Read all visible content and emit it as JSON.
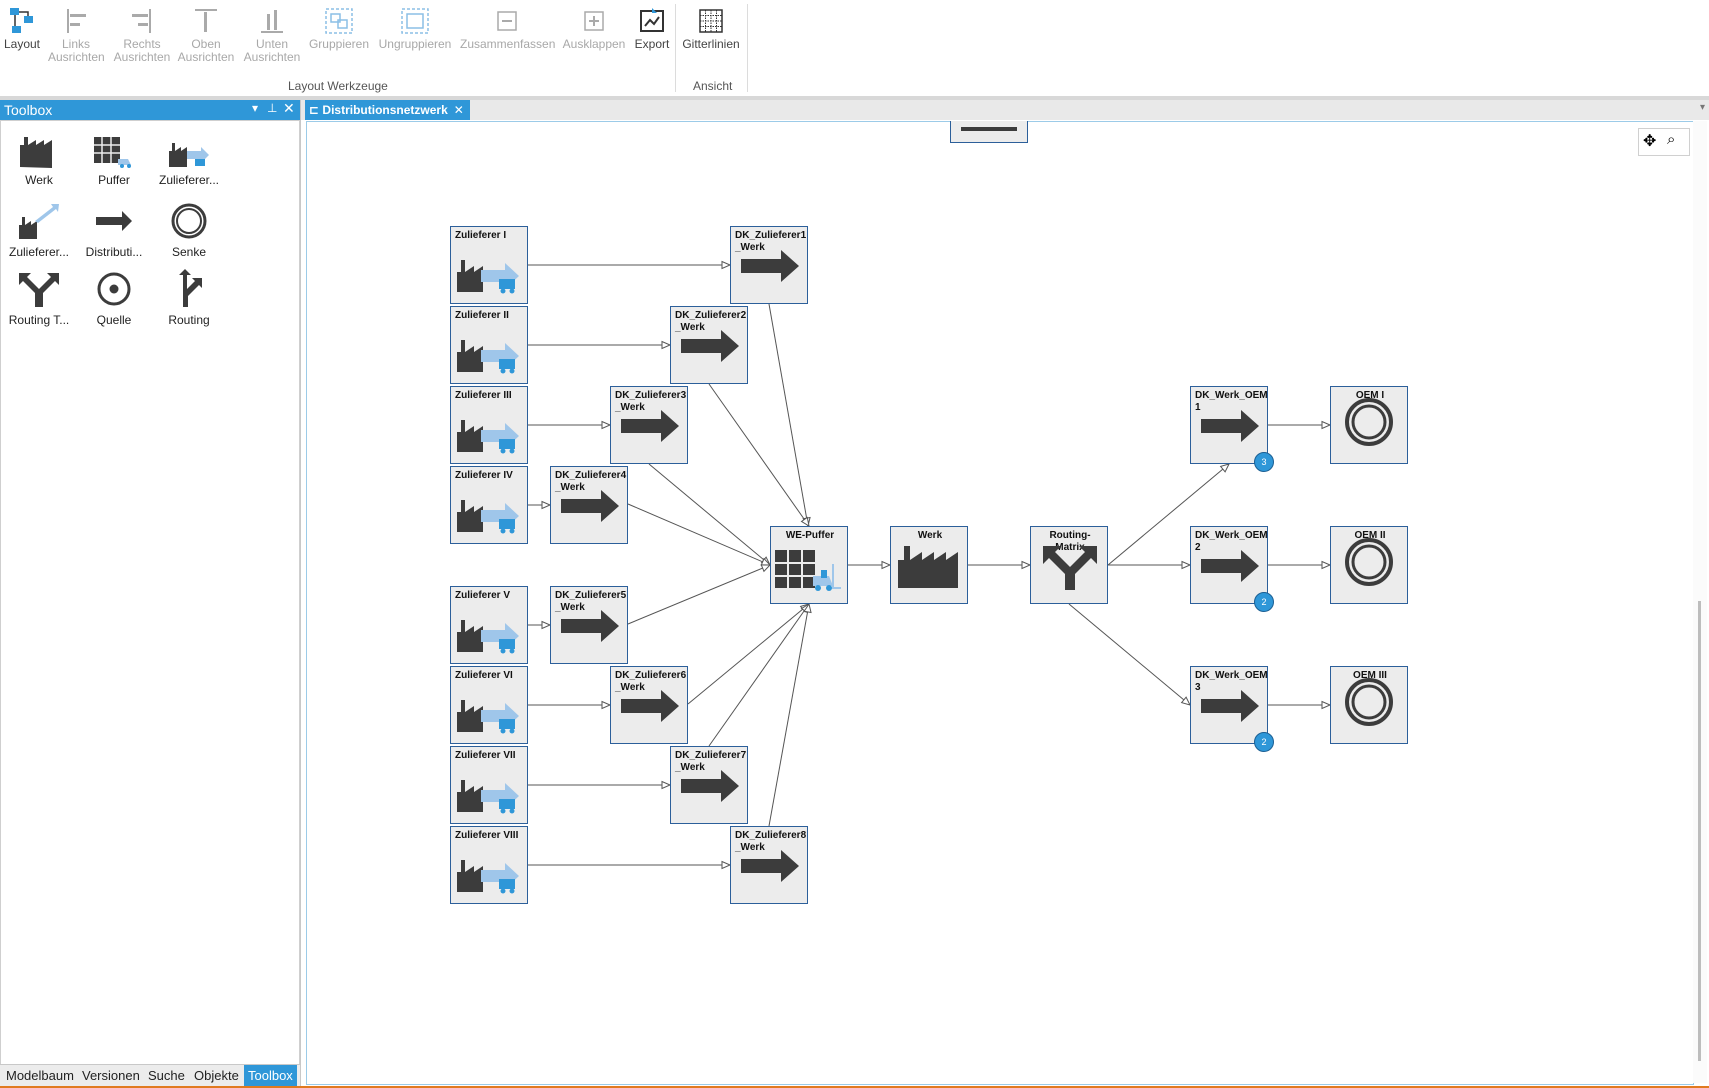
{
  "ribbon": {
    "buttons": [
      {
        "id": "layout",
        "label": "Layout",
        "icon": "layout-icon",
        "enabled": true
      },
      {
        "id": "links",
        "label": "Links\nAusrichten",
        "icon": "align-left-icon",
        "enabled": false
      },
      {
        "id": "rechts",
        "label": "Rechts\nAusrichten",
        "icon": "align-right-icon",
        "enabled": false
      },
      {
        "id": "oben",
        "label": "Oben\nAusrichten",
        "icon": "align-top-icon",
        "enabled": false
      },
      {
        "id": "unten",
        "label": "Unten\nAusrichten",
        "icon": "align-bottom-icon",
        "enabled": false
      },
      {
        "id": "gruppieren",
        "label": "Gruppieren",
        "icon": "group-icon",
        "enabled": false
      },
      {
        "id": "ungruppieren",
        "label": "Ungruppieren",
        "icon": "ungroup-icon",
        "enabled": false
      },
      {
        "id": "zusammenfassen",
        "label": "Zusammenfassen",
        "icon": "collapse-icon",
        "enabled": false
      },
      {
        "id": "ausklappen",
        "label": "Ausklappen",
        "icon": "expand-icon",
        "enabled": false
      },
      {
        "id": "export",
        "label": "Export",
        "icon": "export-icon",
        "enabled": true
      },
      {
        "id": "gitterlinien",
        "label": "Gitterlinien",
        "icon": "grid-icon",
        "enabled": true
      }
    ],
    "group_layout_label": "Layout Werkzeuge",
    "group_view_label": "Ansicht"
  },
  "toolbox": {
    "title": "Toolbox",
    "items": [
      {
        "label": "Werk",
        "icon": "factory-icon"
      },
      {
        "label": "Puffer",
        "icon": "buffer-icon"
      },
      {
        "label": "Zulieferer...",
        "icon": "supplier-icon"
      },
      {
        "label": "Zulieferer...",
        "icon": "supplier-arrow-icon"
      },
      {
        "label": "Distributi...",
        "icon": "arrow-right-icon"
      },
      {
        "label": "Senke",
        "icon": "sink-icon"
      },
      {
        "label": "Routing T...",
        "icon": "fork-icon"
      },
      {
        "label": "Quelle",
        "icon": "source-icon"
      },
      {
        "label": "Routing",
        "icon": "routing-icon"
      }
    ],
    "bottom_tabs": [
      "Modelbaum",
      "Versionen",
      "Suche",
      "Objekte",
      "Toolbox"
    ],
    "active_tab": "Toolbox"
  },
  "document": {
    "tab_title": "Distributionsnetzwerk"
  },
  "diagram": {
    "suppliers": [
      "Zulieferer I",
      "Zulieferer II",
      "Zulieferer III",
      "Zulieferer IV",
      "Zulieferer V",
      "Zulieferer VI",
      "Zulieferer VII",
      "Zulieferer VIII"
    ],
    "dk_supplier": [
      "DK_Zulieferer1\n_Werk",
      "DK_Zulieferer2\n_Werk",
      "DK_Zulieferer3\n_Werk",
      "DK_Zulieferer4\n_Werk",
      "DK_Zulieferer5\n_Werk",
      "DK_Zulieferer6\n_Werk",
      "DK_Zulieferer7\n_Werk",
      "DK_Zulieferer8\n_Werk"
    ],
    "buffer": "WE-Puffer",
    "plant": "Werk",
    "router": "Routing-\nMatrix",
    "dk_oem": [
      "DK_Werk_OEM\n1",
      "DK_Werk_OEM\n2",
      "DK_Werk_OEM\n3"
    ],
    "dk_oem_badges": [
      "3",
      "2",
      "2"
    ],
    "oems": [
      "OEM I",
      "OEM II",
      "OEM III"
    ]
  },
  "colors": {
    "accent": "#2f97d8",
    "node_border": "#2c5f9a",
    "node_fill": "#ececec",
    "icon_dark": "#3c3c3c",
    "icon_light": "#9fc6ea"
  }
}
